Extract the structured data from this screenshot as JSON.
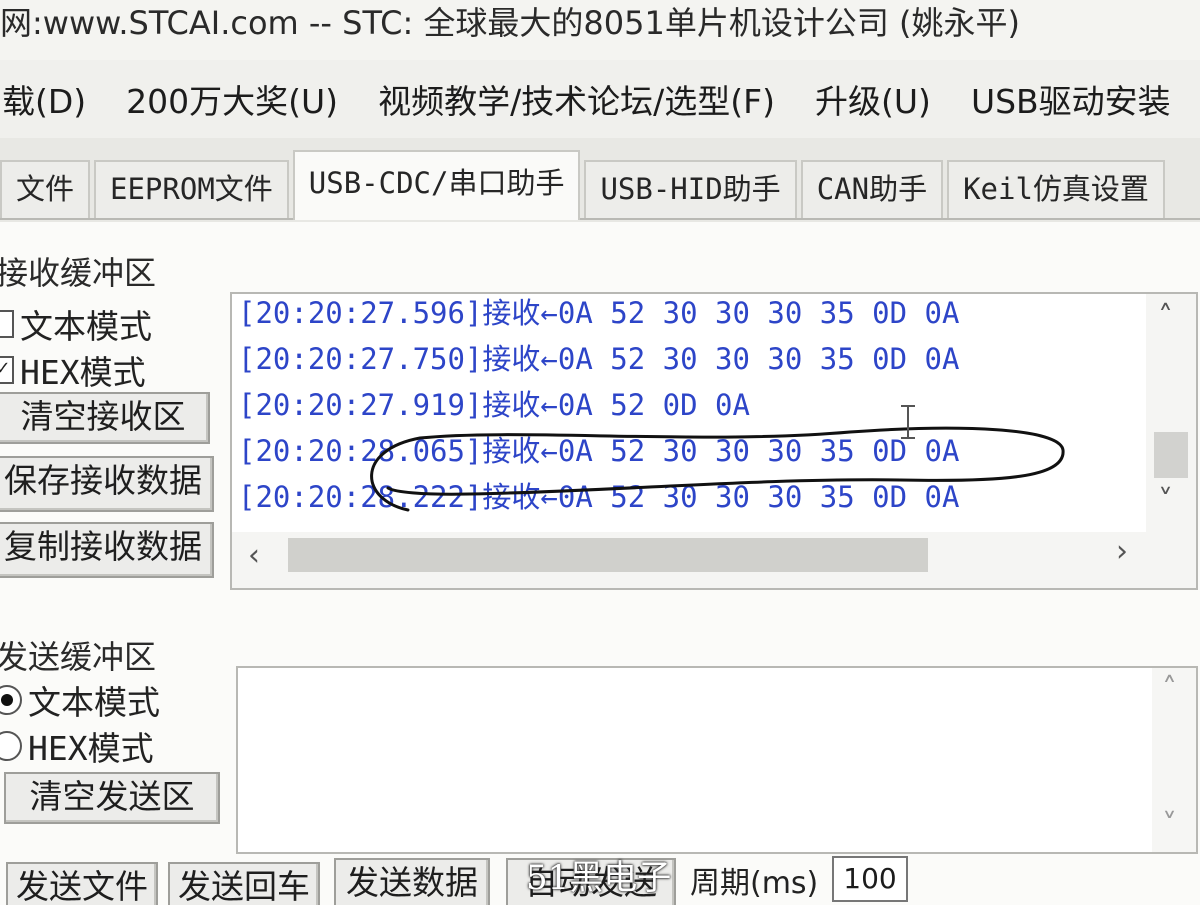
{
  "window": {
    "title": "网:www.STCAI.com  -- STC: 全球最大的8051单片机设计公司 (姚永平)"
  },
  "menu": [
    {
      "label": "载(D)"
    },
    {
      "label": "200万大奖(U)"
    },
    {
      "label": "视频教学/技术论坛/选型(F)"
    },
    {
      "label": "升级(U)"
    },
    {
      "label": "USB驱动安装"
    }
  ],
  "tabs": [
    {
      "label": "文件",
      "active": false
    },
    {
      "label": "EEPROM文件",
      "active": false
    },
    {
      "label": "USB-CDC/串口助手",
      "active": true
    },
    {
      "label": "USB-HID助手",
      "active": false
    },
    {
      "label": "CAN助手",
      "active": false
    },
    {
      "label": "Keil仿真设置",
      "active": false
    }
  ],
  "receive": {
    "section_label": "接收缓冲区",
    "text_mode_label": "文本模式",
    "text_mode_checked": false,
    "hex_mode_label": "HEX模式",
    "hex_mode_checked": true,
    "clear_button": "清空接收区",
    "save_button": "保存接收数据",
    "copy_button": "复制接收数据",
    "lines": [
      "[20:20:27.596]接收←0A 52 30 30 30 35 0D 0A",
      "[20:20:27.750]接收←0A 52 30 30 30 35 0D 0A",
      "[20:20:27.919]接收←0A 52 0D 0A",
      "[20:20:28.065]接收←0A 52 30 30 30 35 0D 0A",
      "[20:20:28.222]接收←0A 52 30 30 30 35 0D 0A"
    ]
  },
  "send": {
    "section_label": "发送缓冲区",
    "text_mode_label": "文本模式",
    "text_mode_selected": true,
    "hex_mode_label": "HEX模式",
    "hex_mode_selected": false,
    "clear_button": "清空发送区",
    "text": ""
  },
  "footer": {
    "send_file_button": "发送文件",
    "send_enter_button": "发送回车",
    "send_data_button": "发送数据",
    "auto_send_button": "自动发送",
    "period_label": "周期(ms)",
    "period_value": "100",
    "watermark": "51黑电子"
  },
  "colors": {
    "receive_text": "#2d45c8",
    "annotation": "#111111"
  }
}
